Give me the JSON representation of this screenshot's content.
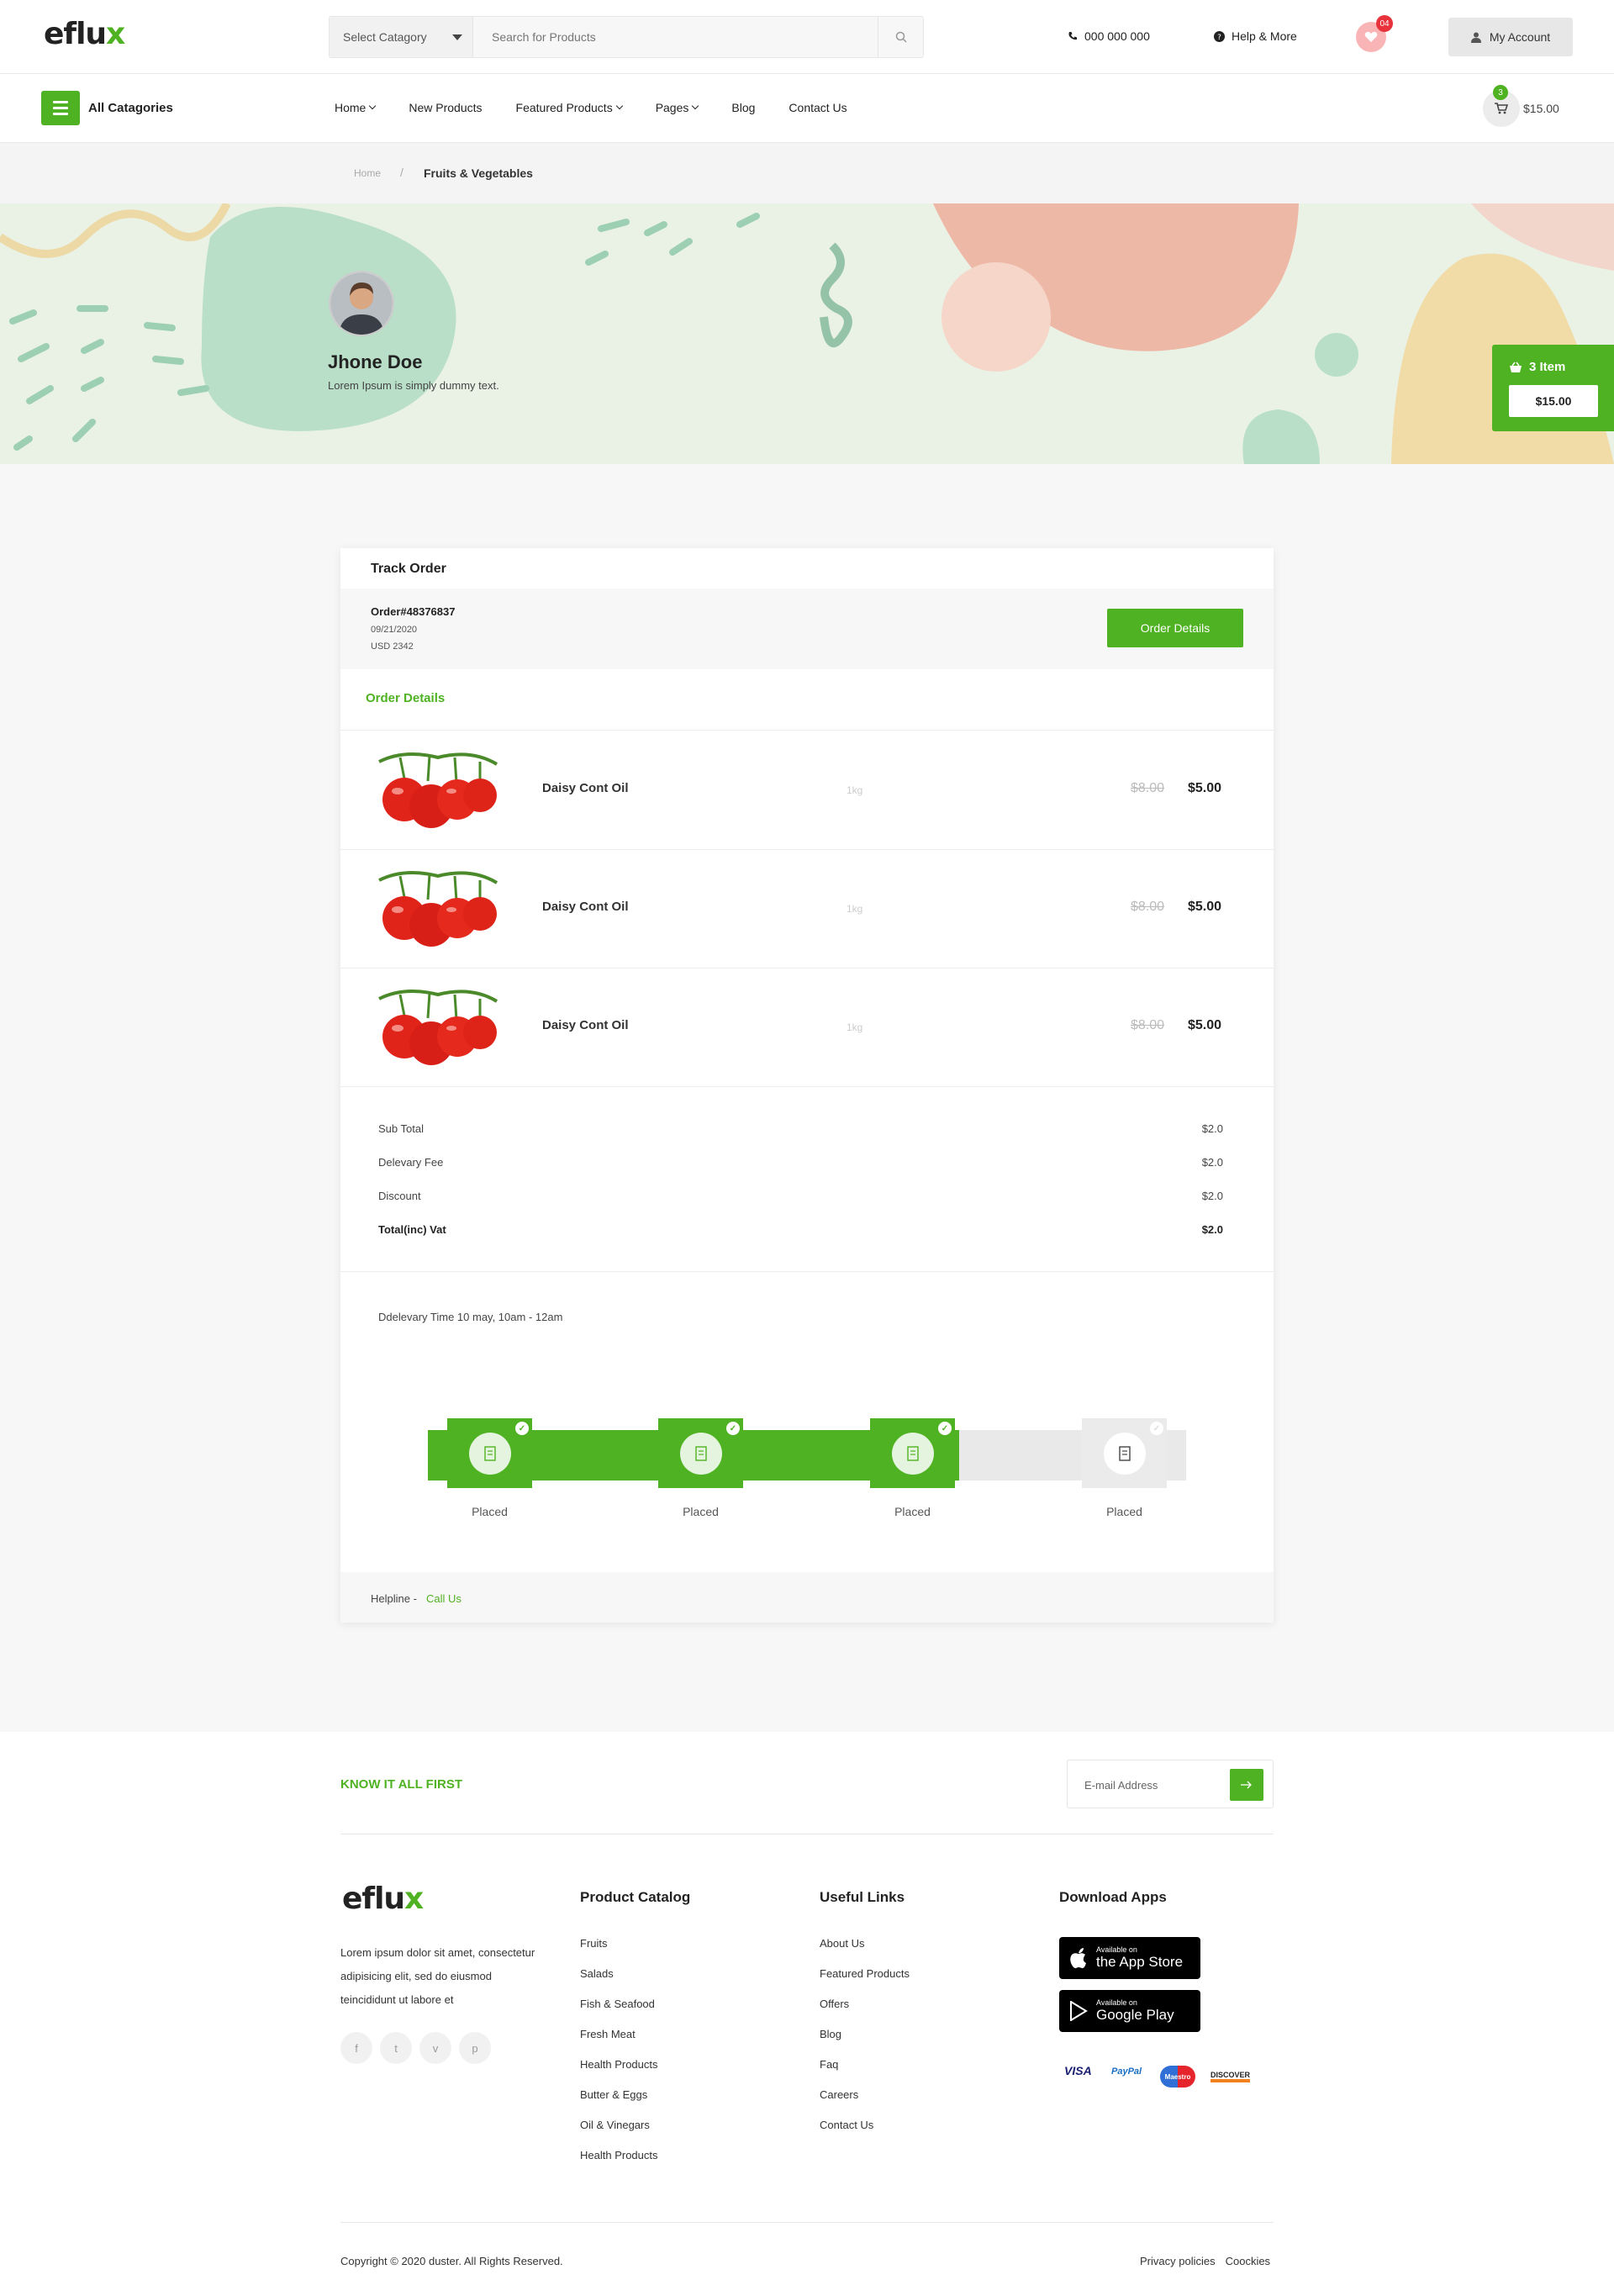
{
  "header": {
    "logo_main": "eflu",
    "logo_accent": "x",
    "search_category": "Select Catagory",
    "search_placeholder": "Search for Products",
    "phone": "000 000 000",
    "help": "Help & More",
    "wishlist_count": "04",
    "account": "My Account"
  },
  "nav": {
    "all_categories": "All Catagories",
    "items": [
      "Home",
      "New Products",
      "Featured Products",
      "Pages",
      "Blog",
      "Contact Us"
    ],
    "cart_count": "3",
    "cart_total": "$15.00"
  },
  "breadcrumb": {
    "home": "Home",
    "separator": "/",
    "current": "Fruits & Vegetables"
  },
  "profile": {
    "name": "Jhone Doe",
    "subtitle": "Lorem Ipsum is simply dummy text."
  },
  "side_cart": {
    "items": "3 Item",
    "total": "$15.00"
  },
  "order": {
    "title": "Track Order",
    "number": "Order#48376837",
    "date": "09/21/2020",
    "amount": "USD 2342",
    "details_button": "Order Details",
    "details_heading": "Order Details",
    "products": [
      {
        "name": "Daisy Cont Oil",
        "weight": "1kg",
        "old_price": "$8.00",
        "price": "$5.00"
      },
      {
        "name": "Daisy Cont Oil",
        "weight": "1kg",
        "old_price": "$8.00",
        "price": "$5.00"
      },
      {
        "name": "Daisy Cont Oil",
        "weight": "1kg",
        "old_price": "$8.00",
        "price": "$5.00"
      }
    ],
    "summary": [
      {
        "label": "Sub Total",
        "value": "$2.0"
      },
      {
        "label": "Delevary Fee",
        "value": "$2.0"
      },
      {
        "label": "Discount",
        "value": "$2.0"
      },
      {
        "label": "Total(inc) Vat",
        "value": "$2.0"
      }
    ],
    "delivery_time": "Ddelevary Time 10 may, 10am - 12am",
    "steps": [
      {
        "label": "Placed",
        "done": true
      },
      {
        "label": "Placed",
        "done": true
      },
      {
        "label": "Placed",
        "done": true
      },
      {
        "label": "Placed",
        "done": false
      }
    ],
    "helpline": "Helpline - ",
    "call_us": "Call Us"
  },
  "footer": {
    "know": "KNOW IT ALL FIRST",
    "email_placeholder": "E-mail Address",
    "about": "Lorem ipsum dolor sit amet, consectetur adipisicing elit, sed do eiusmod teincididunt ut labore et",
    "catalog_title": "Product Catalog",
    "catalog": [
      "Fruits",
      "Salads",
      "Fish & Seafood",
      "Fresh Meat",
      "Health Products",
      "Butter & Eggs",
      "Oil & Vinegars",
      "Health Products"
    ],
    "links_title": "Useful Links",
    "links": [
      "About Us",
      "Featured Products",
      "Offers",
      "Blog",
      "Faq",
      "Careers",
      "Contact Us"
    ],
    "apps_title": "Download Apps",
    "app_store_small": "Available on",
    "app_store_big": "the App Store",
    "google_small": "Available on",
    "google_big": "Google Play",
    "payments": [
      "VISA",
      "PayPal",
      "Maestro",
      "DISCOVER"
    ],
    "copyright": "Copyright © 2020 duster. All Rights Reserved.",
    "privacy": "Privacy policies",
    "cookies": "Coockies"
  },
  "colors": {
    "accent": "#4fb222",
    "badge": "#e8323c"
  }
}
